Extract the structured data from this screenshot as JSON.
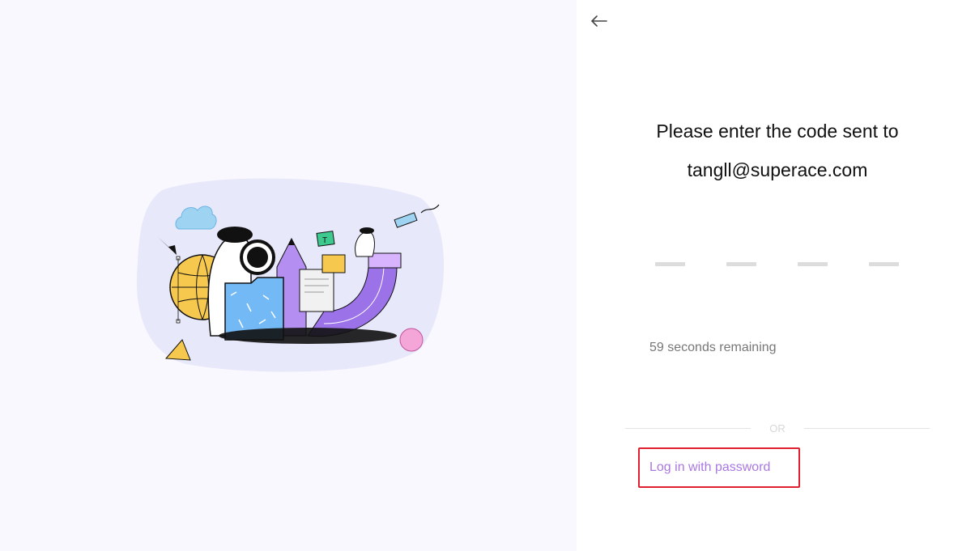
{
  "illustration": {
    "icon": "creative-tools-illustration"
  },
  "header": {
    "back_icon": "arrow-left-icon"
  },
  "verification": {
    "title_line1": "Please enter the code sent to",
    "title_line2": "tangll@superace.com",
    "code_length": 4,
    "countdown": "59 seconds remaining"
  },
  "divider": {
    "label": "OR"
  },
  "alternate": {
    "password_login_label": "Log in with password"
  },
  "colors": {
    "left_bg": "#f9f8fe",
    "accent_purple": "#a978e0",
    "highlight_red": "#e0202e"
  }
}
